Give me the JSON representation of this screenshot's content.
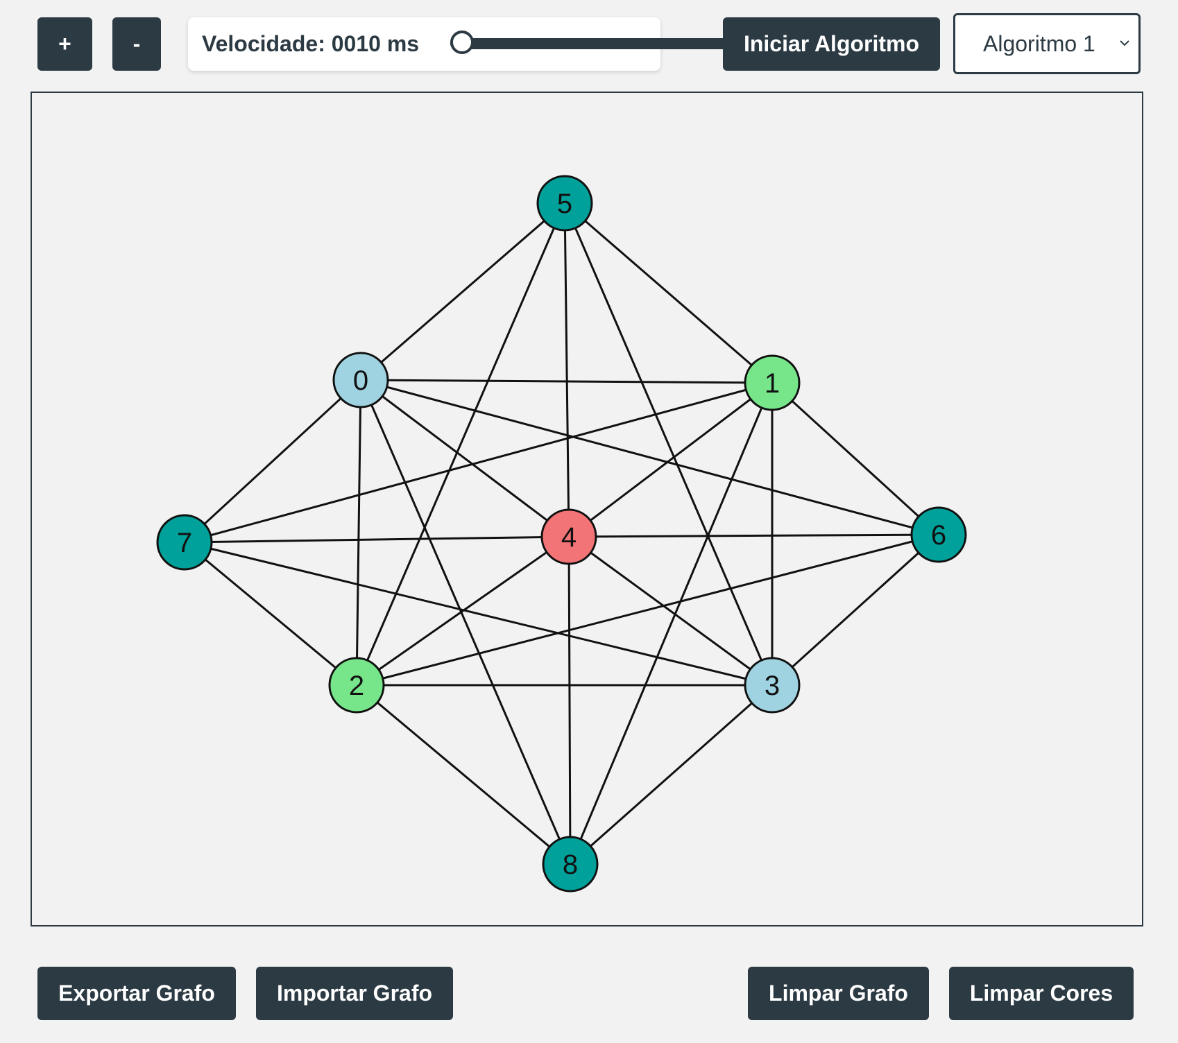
{
  "toolbar": {
    "zoom_in_label": "+",
    "zoom_out_label": "-",
    "speed_label": "Velocidade: 0010 ms",
    "speed_fraction": 0.0,
    "start_label": "Iniciar Algoritmo",
    "algorithm_selected": "Algoritmo 1"
  },
  "footer": {
    "export_label": "Exportar Grafo",
    "import_label": "Importar Grafo",
    "clear_graph_label": "Limpar Grafo",
    "clear_colors_label": "Limpar Cores"
  },
  "colors": {
    "button_bg": "#2c3a43",
    "teal": "#00a19a",
    "light_blue": "#9fd3e1",
    "light_green": "#77e68a",
    "red": "#f37476",
    "edge": "#111111"
  },
  "graph": {
    "nodes": [
      {
        "id": "0",
        "color": "#9fd3e1"
      },
      {
        "id": "1",
        "color": "#77e68a"
      },
      {
        "id": "2",
        "color": "#77e68a"
      },
      {
        "id": "3",
        "color": "#9fd3e1"
      },
      {
        "id": "4",
        "color": "#f37476"
      },
      {
        "id": "5",
        "color": "#00a19a"
      },
      {
        "id": "6",
        "color": "#00a19a"
      },
      {
        "id": "7",
        "color": "#00a19a"
      },
      {
        "id": "8",
        "color": "#00a19a"
      }
    ],
    "edges": [
      [
        "5",
        "0"
      ],
      [
        "5",
        "1"
      ],
      [
        "5",
        "2"
      ],
      [
        "5",
        "4"
      ],
      [
        "5",
        "3"
      ],
      [
        "0",
        "1"
      ],
      [
        "0",
        "7"
      ],
      [
        "0",
        "2"
      ],
      [
        "0",
        "8"
      ],
      [
        "0",
        "4"
      ],
      [
        "0",
        "6"
      ],
      [
        "1",
        "7"
      ],
      [
        "1",
        "4"
      ],
      [
        "1",
        "6"
      ],
      [
        "1",
        "3"
      ],
      [
        "1",
        "8"
      ],
      [
        "7",
        "4"
      ],
      [
        "7",
        "2"
      ],
      [
        "7",
        "3"
      ],
      [
        "4",
        "6"
      ],
      [
        "4",
        "2"
      ],
      [
        "4",
        "3"
      ],
      [
        "4",
        "8"
      ],
      [
        "6",
        "2"
      ],
      [
        "6",
        "3"
      ],
      [
        "2",
        "3"
      ],
      [
        "2",
        "8"
      ],
      [
        "3",
        "8"
      ]
    ]
  }
}
